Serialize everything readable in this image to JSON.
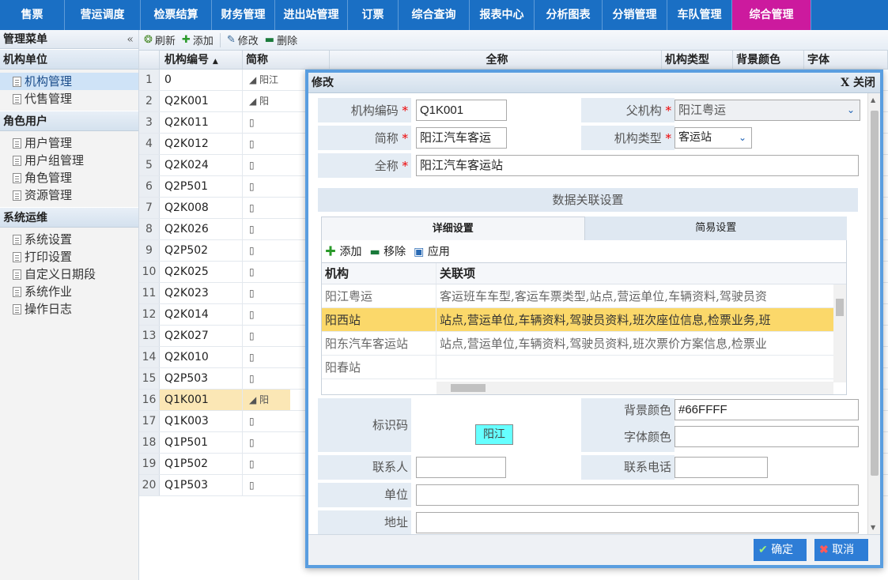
{
  "topnav": {
    "items": [
      "售票",
      "营运调度",
      "检票结算",
      "财务管理",
      "进出站管理",
      "订票",
      "综合查询",
      "报表中心",
      "分析图表",
      "分销管理",
      "车队管理",
      "综合管理"
    ],
    "active_index": 11
  },
  "sidebar": {
    "title": "管理菜单",
    "collapse_icon": "«",
    "groups": [
      {
        "title": "机构单位",
        "items": [
          "机构管理",
          "代售管理"
        ]
      },
      {
        "title": "角色用户",
        "items": [
          "用户管理",
          "用户组管理",
          "角色管理",
          "资源管理"
        ]
      },
      {
        "title": "系统运维",
        "items": [
          "系统设置",
          "打印设置",
          "自定义日期段",
          "系统作业",
          "操作日志"
        ]
      }
    ],
    "active_item": "机构管理"
  },
  "toolbar": {
    "refresh": "刷新",
    "add": "添加",
    "edit": "修改",
    "delete": "删除"
  },
  "grid": {
    "headers": [
      "机构编号",
      "简称",
      "全称",
      "机构类型",
      "背景颜色",
      "字体"
    ],
    "sort_indicator": "▲",
    "rows": [
      {
        "num": "1",
        "code": "0"
      },
      {
        "num": "2",
        "code": "Q2K001"
      },
      {
        "num": "3",
        "code": "Q2K011"
      },
      {
        "num": "4",
        "code": "Q2K012"
      },
      {
        "num": "5",
        "code": "Q2K024"
      },
      {
        "num": "6",
        "code": "Q2P501"
      },
      {
        "num": "7",
        "code": "Q2K008"
      },
      {
        "num": "8",
        "code": "Q2K026"
      },
      {
        "num": "9",
        "code": "Q2P502"
      },
      {
        "num": "10",
        "code": "Q2K025"
      },
      {
        "num": "11",
        "code": "Q2K023"
      },
      {
        "num": "12",
        "code": "Q2K014"
      },
      {
        "num": "13",
        "code": "Q2K027"
      },
      {
        "num": "14",
        "code": "Q2K010"
      },
      {
        "num": "15",
        "code": "Q2P503"
      },
      {
        "num": "16",
        "code": "Q1K001"
      },
      {
        "num": "17",
        "code": "Q1K003"
      },
      {
        "num": "18",
        "code": "Q1P501"
      },
      {
        "num": "19",
        "code": "Q1P502"
      },
      {
        "num": "20",
        "code": "Q1P503"
      }
    ],
    "selected_num": "16",
    "tree_rows": {
      "1": "◢ 阳江",
      "2": "◢ 阳",
      "16": "◢ 阳"
    }
  },
  "modal": {
    "title": "修改",
    "close": "X 关闭",
    "fields": {
      "code_label": "机构编码",
      "code_value": "Q1K001",
      "parent_label": "父机构",
      "parent_value": "阳江粤运",
      "short_label": "简称",
      "short_value": "阳江汽车客运",
      "type_label": "机构类型",
      "type_value": "客运站",
      "full_label": "全称",
      "full_value": "阳江汽车客运站",
      "required_mark": "*"
    },
    "section_title": "数据关联设置",
    "tabs": [
      "详细设置",
      "简易设置"
    ],
    "subtoolbar": {
      "add": "添加",
      "remove": "移除",
      "apply": "应用"
    },
    "relations": {
      "headers": [
        "机构",
        "关联项"
      ],
      "rows": [
        {
          "org": "阳江粤运",
          "items": "客运班车车型,客运车票类型,站点,营运单位,车辆资料,驾驶员资"
        },
        {
          "org": "阳西站",
          "items": "站点,营运单位,车辆资料,驾驶员资料,班次座位信息,检票业务,班"
        },
        {
          "org": "阳东汽车客运站",
          "items": "站点,营运单位,车辆资料,驾驶员资料,班次票价方案信息,检票业"
        },
        {
          "org": "阳春站",
          "items": ""
        }
      ],
      "selected_index": 1
    },
    "ident_label": "标识码",
    "ident_value": "阳江",
    "bg_label": "背景颜色",
    "bg_value": "#66FFFF",
    "font_label": "字体颜色",
    "font_value": "",
    "contact_label": "联系人",
    "contact_value": "",
    "phone_label": "联系电话",
    "phone_value": "",
    "unit_label": "单位",
    "unit_value": "",
    "addr_label": "地址",
    "addr_value": "",
    "ok": "确定",
    "cancel": "取消"
  },
  "colors": {
    "nav": "#1a6fc4",
    "nav_active": "#cc1a9e",
    "row_selected": "#fbe7b5",
    "mark_bg": "#66ffff"
  }
}
